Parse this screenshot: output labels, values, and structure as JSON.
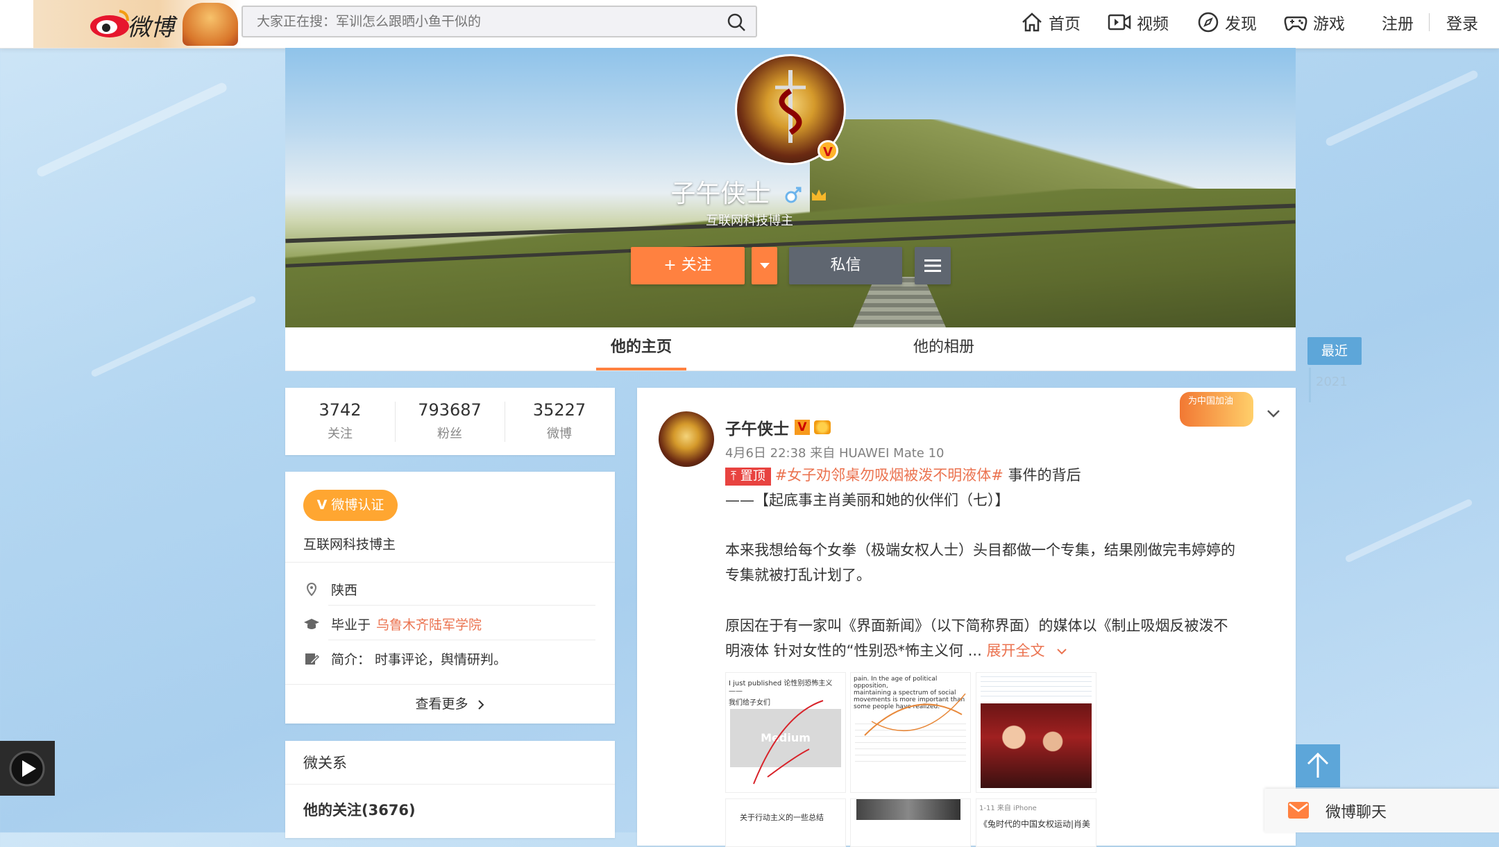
{
  "header": {
    "logo_text": "微博",
    "search_placeholder": "大家正在搜：军训怎么跟晒小鱼干似的",
    "nav": {
      "home": "首页",
      "video": "视频",
      "discover": "发现",
      "games": "游戏",
      "register": "注册",
      "login": "登录"
    }
  },
  "profile": {
    "name": "子午侠士",
    "description": "互联网科技博主",
    "follow_label": "+ 关注",
    "message_label": "私信"
  },
  "tabs": {
    "home": "他的主页",
    "album": "他的相册"
  },
  "timeline": {
    "recent": "最近",
    "year": "2021"
  },
  "stats": [
    {
      "value": "3742",
      "label": "关注"
    },
    {
      "value": "793687",
      "label": "粉丝"
    },
    {
      "value": "35227",
      "label": "微博"
    }
  ],
  "info": {
    "cert_label": "微博认证",
    "cert_desc": "互联网科技博主",
    "location": "陕西",
    "edu_prefix": "毕业于",
    "edu_school": "乌鲁木齐陆军学院",
    "bio": "简介： 时事评论，舆情研判。",
    "see_more": "查看更多"
  },
  "relations": {
    "title": "微关系",
    "following": "他的关注(3676)"
  },
  "post": {
    "author": "子午侠士",
    "meta": "4月6日 22:38 来自 HUAWEI Mate 10",
    "badge": "为中国加油",
    "pin": "置顶",
    "topic": "#女子劝邻桌勿吸烟被泼不明液体#",
    "title_rest": "事件的背后",
    "subtitle": "——【起底事主肖美丽和她的伙伴们（七）】",
    "para1a": "本来我想给每个女拳（极端女权人士）头目都做一个专集，结果刚做完韦婷婷的",
    "para1b": "专集就被打乱计划了。",
    "para2a": "原因在于有一家叫《界面新闻》（以下简称界面）的媒体以《制止吸烟反被泼不",
    "para2b": "明液体 针对女性的“性别恐*怖主义何 ...",
    "expand": "展开全文",
    "thumbs": {
      "t1_line1": "I just published 论性别恐怖主义——",
      "t1_line2": "我们给子女们",
      "t1_logo": "Medium",
      "t2_line1": "pain. In the age of political opposition,",
      "t2_line2": "maintaining a spectrum of social",
      "t2_line3": "movements is more important than",
      "t2_line4": "some people have realized.",
      "t5_line1": "关于行动主义的一些总结",
      "t6_line1": "1-11 来自 iPhone",
      "t6_line2": "《兔时代的中国女权运动|肖美"
    }
  },
  "chat": {
    "label": "微博聊天"
  }
}
